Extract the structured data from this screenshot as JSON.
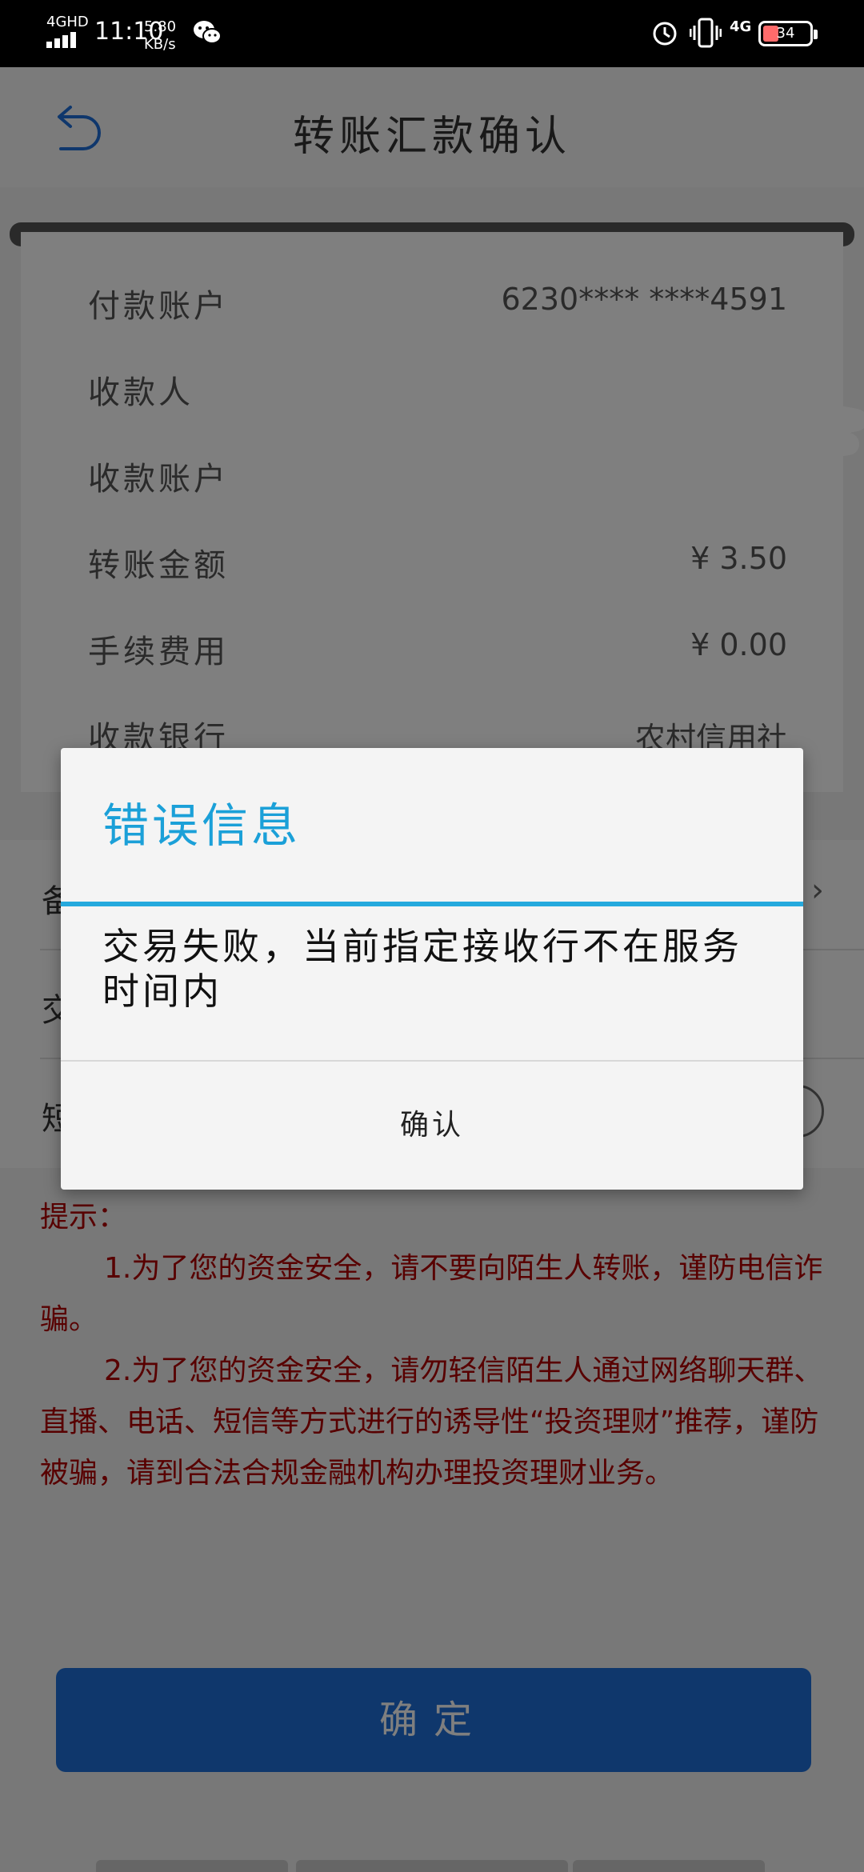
{
  "status_bar": {
    "network": "4GHD",
    "time": "11:10",
    "speed_value": "5.80",
    "speed_unit": "KB/s",
    "mobile_data": "4G",
    "battery": "34",
    "battery_level_percent": 34
  },
  "header": {
    "title": "转账汇款确认"
  },
  "receipt": {
    "rows": [
      {
        "label": "付款账户",
        "value": "6230**** ****4591"
      },
      {
        "label": "收款人",
        "value": ""
      },
      {
        "label": "收款账户",
        "value": ""
      },
      {
        "label": "转账金额",
        "value": "¥ 3.50"
      },
      {
        "label": "手续费用",
        "value": "¥ 0.00"
      },
      {
        "label": "收款银行",
        "value": "农村信用社"
      }
    ]
  },
  "form": {
    "labels": [
      "备",
      "交",
      "短"
    ]
  },
  "tips": {
    "heading": "提示：",
    "items": [
      "1.为了您的资金安全，请不要向陌生人转账，谨防电信诈骗。",
      "2.为了您的资金安全，请勿轻信陌生人通过网络聊天群、直播、电话、短信等方式进行的诱导性“投资理财”推荐，谨防被骗，请到合法合规金融机构办理投资理财业务。"
    ]
  },
  "confirm_button": {
    "label": "确定"
  },
  "dialog": {
    "title": "错误信息",
    "message": "交易失败，当前指定接收行不在服务时间内",
    "button": "确认"
  },
  "colors": {
    "accent": "#25a9dd",
    "button_blue": "#1e6fd8",
    "tip_red": "#b00000"
  }
}
